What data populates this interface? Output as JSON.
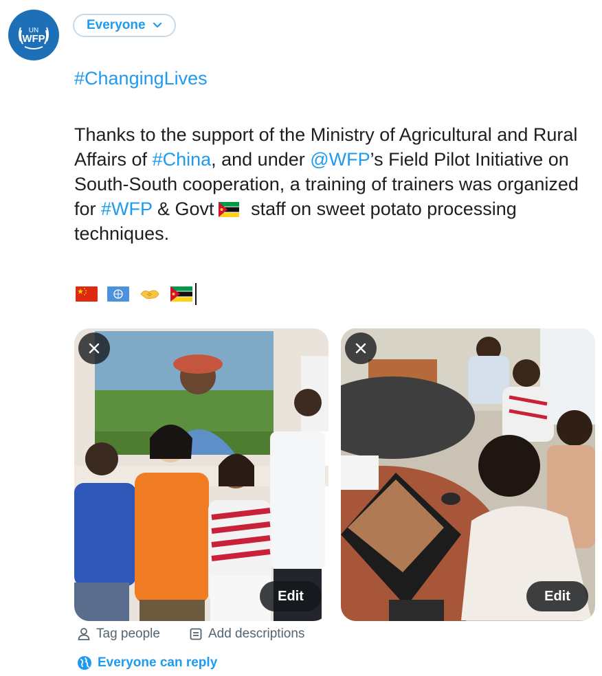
{
  "avatar": {
    "line1": "UN",
    "line2": "WFP",
    "color": "#1d6fb8"
  },
  "audience_label": "Everyone",
  "tweet": {
    "heading": "#ChangingLives",
    "t1": "Thanks to the support of the Ministry of Agricultural and Rural Affairs of ",
    "tag_china": "#China",
    "t2": ", and under ",
    "mention_wfp": "@WFP",
    "t3": "’s Field Pilot Initiative on South-South cooperation, a training of trainers was organized for ",
    "tag_wfp": "#WFP",
    "t4": " & Govt",
    "t5": "staff on sweet potato processing techniques."
  },
  "emojis": [
    "flag-china-icon",
    "flag-un-icon",
    "handshake-icon",
    "flag-mozambique-icon"
  ],
  "media": [
    {
      "edit_label": "Edit"
    },
    {
      "edit_label": "Edit"
    }
  ],
  "actions": {
    "tag_people": "Tag people",
    "add_descriptions": "Add descriptions",
    "reply_setting": "Everyone can reply"
  },
  "colors": {
    "accent": "#1d9bf0",
    "text": "#1c1e21",
    "muted": "#536471"
  }
}
